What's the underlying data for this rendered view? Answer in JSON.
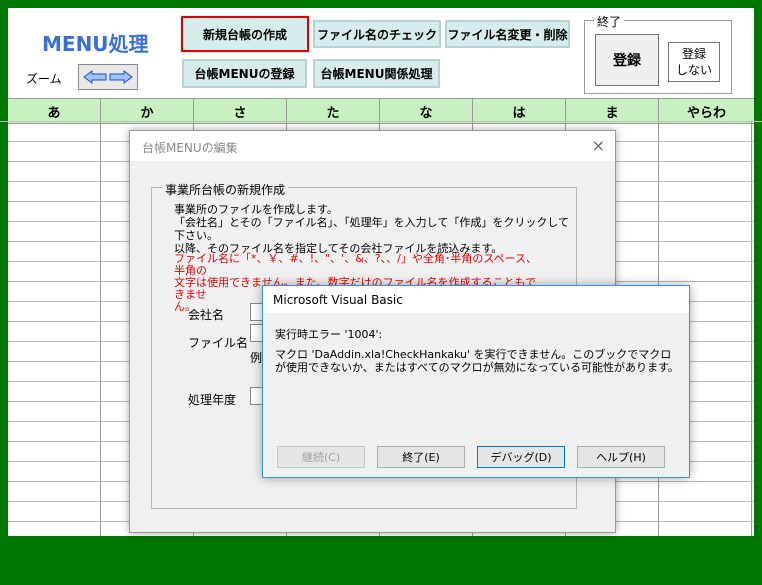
{
  "header": {
    "title": "MENU処理",
    "zoom_label": "ズーム",
    "buttons": {
      "new_ledger": "新規台帳の作成",
      "filename_check": "ファイル名のチェック",
      "filename_change": "ファイル名変更・削除",
      "ledger_menu_register": "台帳MENUの登録",
      "ledger_menu_related": "台帳MENU関係処理"
    },
    "end_group": {
      "legend": "終了",
      "register": "登録",
      "no_register_line1": "登録",
      "no_register_line2": "しない"
    }
  },
  "kana_tabs": [
    "あ",
    "か",
    "さ",
    "た",
    "な",
    "は",
    "ま",
    "やらわ"
  ],
  "edit_dialog": {
    "title": "台帳MENUの編集",
    "close": "×",
    "group_legend": "事業所台帳の新規作成",
    "description": [
      "事業所のファイルを作成します。",
      "「会社名」とその「ファイル名」、「処理年」を入力して「作成」をクリックして下さい。",
      "以降、そのファイル名を指定してその会社ファイルを読込みます。"
    ],
    "warning": [
      "ファイル名に「*、￥、#、!、\"、'、&、?、、/」や全角･半角のスペース、 半角の",
      "文字は使用できません。また、数字だけのファイル名を作成することもできませ",
      "ん。"
    ],
    "fields": {
      "company_name": "会社名",
      "file_name": "ファイル名",
      "example": "例",
      "fiscal_year": "処理年度"
    }
  },
  "error_dialog": {
    "title": "Microsoft Visual Basic",
    "code": "実行時エラー '1004':",
    "message": "マクロ 'DaAddin.xla!CheckHankaku' を実行できません。このブックでマクロが使用できないか、またはすべてのマクロが無効になっている可能性があります。",
    "buttons": {
      "continue": "継続(C)",
      "end": "終了(E)",
      "debug": "デバッグ(D)",
      "help": "ヘルプ(H)"
    }
  }
}
